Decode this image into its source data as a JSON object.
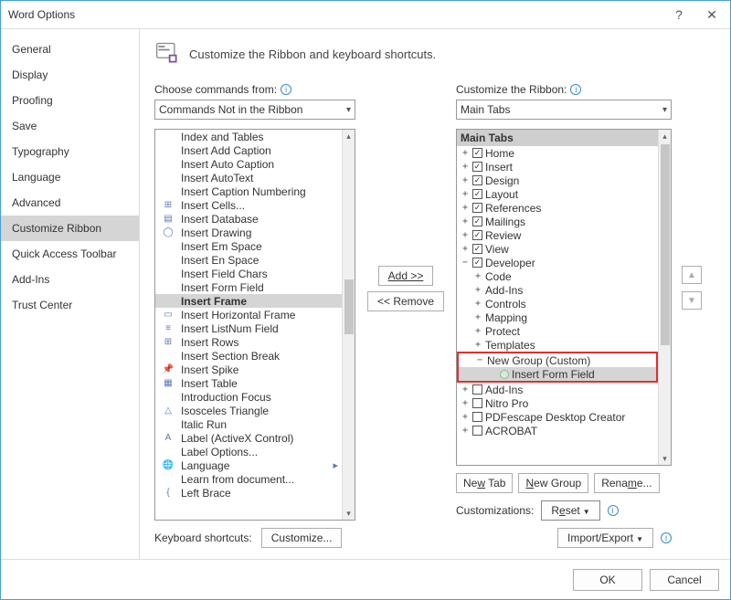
{
  "window": {
    "title": "Word Options"
  },
  "sidebar": {
    "items": [
      {
        "label": "General"
      },
      {
        "label": "Display"
      },
      {
        "label": "Proofing"
      },
      {
        "label": "Save"
      },
      {
        "label": "Typography"
      },
      {
        "label": "Language"
      },
      {
        "label": "Advanced"
      },
      {
        "label": "Customize Ribbon",
        "active": true
      },
      {
        "label": "Quick Access Toolbar"
      },
      {
        "label": "Add-Ins"
      },
      {
        "label": "Trust Center"
      }
    ]
  },
  "heading": "Customize the Ribbon and keyboard shortcuts.",
  "left": {
    "label": "Choose commands from:",
    "dropdown": "Commands Not in the Ribbon",
    "items": [
      "Index and Tables",
      "Insert Add Caption",
      "Insert Auto Caption",
      "Insert AutoText",
      "Insert Caption Numbering",
      "Insert Cells...",
      "Insert Database",
      "Insert Drawing",
      "Insert Em Space",
      "Insert En Space",
      "Insert Field Chars",
      "Insert Form Field",
      "Insert Frame",
      "Insert Horizontal Frame",
      "Insert ListNum Field",
      "Insert Rows",
      "Insert Section Break",
      "Insert Spike",
      "Insert Table",
      "Introduction Focus",
      "Isosceles Triangle",
      "Italic Run",
      "Label (ActiveX Control)",
      "Label Options...",
      "Language",
      "Learn from document...",
      "Left Brace"
    ],
    "selected": "Insert Frame"
  },
  "mid": {
    "add": "Add >>",
    "remove": "<< Remove"
  },
  "right": {
    "label": "Customize the Ribbon:",
    "dropdown": "Main Tabs",
    "treehead": "Main Tabs",
    "tabs": [
      {
        "label": "Home",
        "chk": true,
        "exp": "+"
      },
      {
        "label": "Insert",
        "chk": true,
        "exp": "+"
      },
      {
        "label": "Design",
        "chk": true,
        "exp": "+"
      },
      {
        "label": "Layout",
        "chk": true,
        "exp": "+"
      },
      {
        "label": "References",
        "chk": true,
        "exp": "+"
      },
      {
        "label": "Mailings",
        "chk": true,
        "exp": "+"
      },
      {
        "label": "Review",
        "chk": true,
        "exp": "+"
      },
      {
        "label": "View",
        "chk": true,
        "exp": "+"
      }
    ],
    "dev": {
      "label": "Developer",
      "chk": true,
      "groups": [
        "Code",
        "Add-Ins",
        "Controls",
        "Mapping",
        "Protect",
        "Templates"
      ],
      "custom_group": "New Group (Custom)",
      "custom_item": "Insert Form Field"
    },
    "extras": [
      {
        "label": "Add-Ins",
        "chk": false
      },
      {
        "label": "Nitro Pro",
        "chk": false
      },
      {
        "label": "PDFescape Desktop Creator",
        "chk": false
      },
      {
        "label": "ACROBAT",
        "chk": false
      }
    ],
    "actions": {
      "newtab": "New Tab",
      "newgroup": "New Group",
      "rename": "Rename..."
    },
    "cust_label": "Customizations:",
    "reset": "Reset",
    "impexp": "Import/Export"
  },
  "kb": {
    "label": "Keyboard shortcuts:",
    "btn": "Customize..."
  },
  "footer": {
    "ok": "OK",
    "cancel": "Cancel"
  }
}
